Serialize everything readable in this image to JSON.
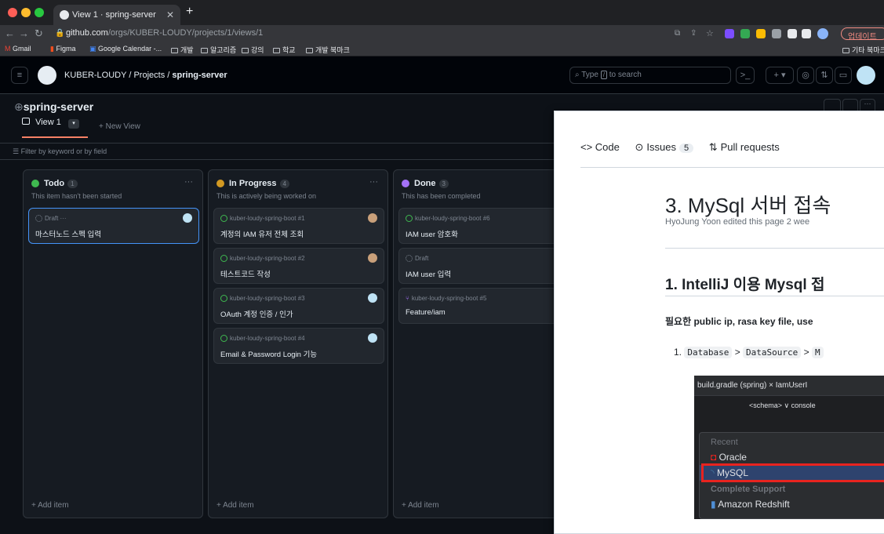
{
  "browser": {
    "tab_title": "View 1 · spring-server",
    "url_host": "github.com",
    "url_path": "/orgs/KUBER-LOUDY/projects/1/views/1",
    "update_label": "업데이트",
    "bookmarks": [
      "Gmail",
      "Figma",
      "Google Calendar -...",
      "개발",
      "알고리즘",
      "강의",
      "학교",
      "개발 북마크"
    ],
    "other_bookmarks": "기타 북마크"
  },
  "header": {
    "org": "KUBER-LOUDY",
    "sep1": "/",
    "projects": "Projects",
    "sep2": "/",
    "project": "spring-server",
    "search_prefix": "Type",
    "search_key": "/",
    "search_suffix": "to search"
  },
  "project": {
    "title": "spring-server",
    "view_tab": "View 1",
    "new_view": "+ New View",
    "filter_placeholder": "Filter by keyword or by field"
  },
  "columns": [
    {
      "name": "Todo",
      "count": "1",
      "desc": "This item hasn't been started",
      "color": "#3fb950",
      "add_label": "+ Add item",
      "cards": [
        {
          "meta": "Draft ···",
          "title": "마스터노드 스펙 입력"
        }
      ]
    },
    {
      "name": "In Progress",
      "count": "4",
      "desc": "This is actively being worked on",
      "color": "#d29922",
      "add_label": "+ Add item",
      "cards": [
        {
          "meta": "kuber-loudy-spring-boot #1",
          "title": "계정의 IAM 유저 전체 조회"
        },
        {
          "meta": "kuber-loudy-spring-boot #2",
          "title": "테스트코드 작성"
        },
        {
          "meta": "kuber-loudy-spring-boot #3",
          "title": "OAuth 계정 인증 / 인가"
        },
        {
          "meta": "kuber-loudy-spring-boot #4",
          "title": "Email & Password Login 기능"
        }
      ]
    },
    {
      "name": "Done",
      "count": "3",
      "desc": "This has been completed",
      "color": "#a371f7",
      "add_label": "+ Add item",
      "cards": [
        {
          "meta": "kuber-loudy-spring-boot #6",
          "title": "IAM user 암호화"
        },
        {
          "meta": "Draft",
          "title": "IAM user 입력"
        },
        {
          "meta": "kuber-loudy-spring-boot #5",
          "title": "Feature/iam"
        }
      ]
    }
  ],
  "overlay": {
    "nav_code": "<> Code",
    "nav_issues": "Issues",
    "issues_count": "5",
    "nav_pr": "Pull requests",
    "h1": "3. MySql 서버 접속",
    "subtitle": "HyoJung Yoon edited this page 2 wee",
    "h2": "1. IntelliJ 이용 Mysql 접",
    "para": "필요한 public ip, rasa key file, use",
    "list_num": "1.",
    "code1": "Database",
    "gt1": ">",
    "code2": "DataSource",
    "gt2": ">",
    "code3": "M",
    "ide_tabs": "build.gradle (spring) ×   IamUserI",
    "ide_tool": "<schema> ∨    console",
    "ide_recent": "Recent",
    "ide_oracle": "Oracle",
    "ide_mysql": "MySQL",
    "ide_complete": "Complete Support",
    "ide_redshift": "Amazon Redshift"
  }
}
